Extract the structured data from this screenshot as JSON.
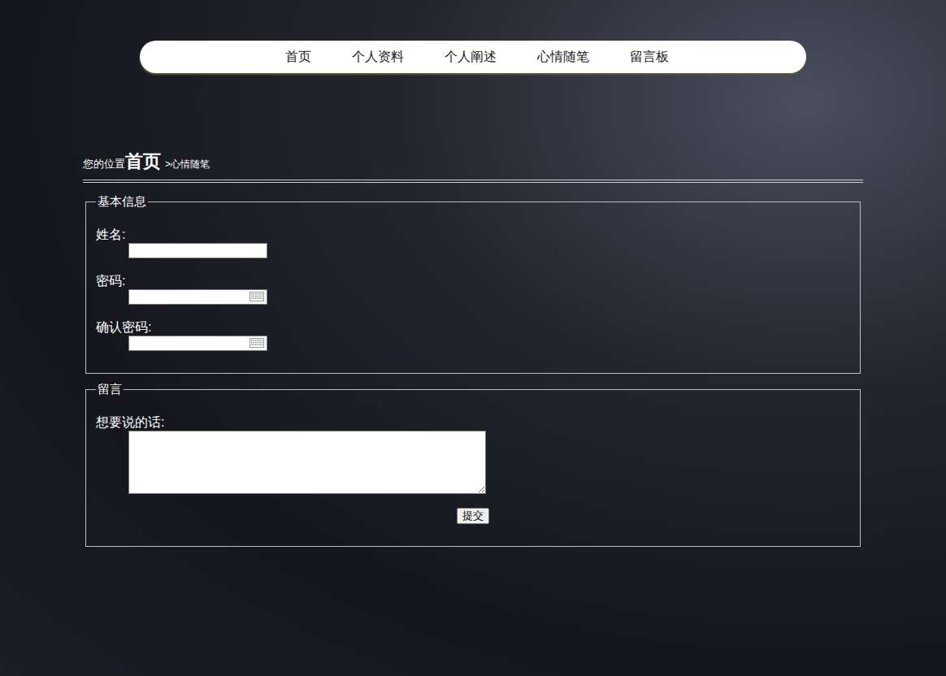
{
  "nav": [
    {
      "label": "首页"
    },
    {
      "label": "个人资料"
    },
    {
      "label": "个人阐述"
    },
    {
      "label": "心情随笔"
    },
    {
      "label": "留言板"
    }
  ],
  "breadcrumb": {
    "prefix": "您的位置",
    "home": "首页",
    "current": ">心情随笔"
  },
  "fieldsets": [
    {
      "legend": "基本信息",
      "fields": [
        {
          "label": "姓名:",
          "kind": "text"
        },
        {
          "label": "密码:",
          "kind": "password"
        },
        {
          "label": "确认密码:",
          "kind": "password"
        }
      ]
    },
    {
      "legend": "留言",
      "fields": [
        {
          "label": "想要说的话:",
          "kind": "textarea"
        }
      ]
    }
  ],
  "submit": "提交"
}
